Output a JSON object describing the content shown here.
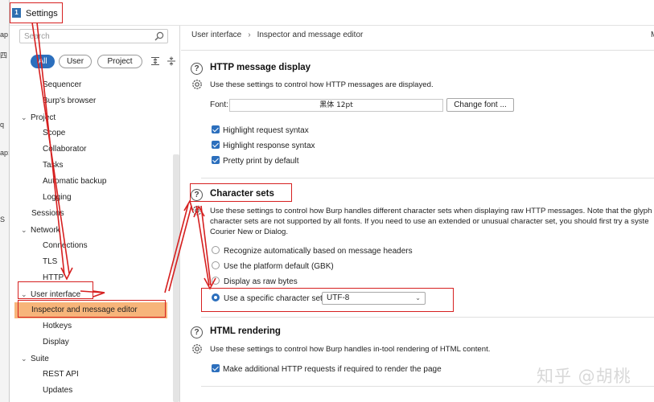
{
  "background_window": {
    "fragments": [
      "ap",
      "四",
      "q",
      "ap:",
      "S"
    ]
  },
  "window": {
    "title": "Settings",
    "app_icon": "app-logo-icon"
  },
  "sidebar": {
    "search_placeholder": "Search",
    "filters": {
      "all": "All",
      "user": "User",
      "project": "Project"
    },
    "tree": [
      {
        "label": "Sequencer",
        "level": 2
      },
      {
        "label": "Burp's browser",
        "level": 2
      },
      {
        "label": "Project",
        "level": 1,
        "expanded": true
      },
      {
        "label": "Scope",
        "level": 2
      },
      {
        "label": "Collaborator",
        "level": 2
      },
      {
        "label": "Tasks",
        "level": 2
      },
      {
        "label": "Automatic backup",
        "level": 2
      },
      {
        "label": "Logging",
        "level": 2
      },
      {
        "label": "Sessions",
        "level": 1
      },
      {
        "label": "Network",
        "level": 1,
        "expanded": true
      },
      {
        "label": "Connections",
        "level": 2
      },
      {
        "label": "TLS",
        "level": 2
      },
      {
        "label": "HTTP",
        "level": 2
      },
      {
        "label": "User interface",
        "level": 1,
        "expanded": true
      },
      {
        "label": "Inspector and message editor",
        "level": 2,
        "selected": true
      },
      {
        "label": "Hotkeys",
        "level": 2
      },
      {
        "label": "Display",
        "level": 2
      },
      {
        "label": "Suite",
        "level": 1,
        "expanded": true
      },
      {
        "label": "REST API",
        "level": 2
      },
      {
        "label": "Updates",
        "level": 2
      }
    ]
  },
  "main": {
    "breadcrumb": {
      "parent": "User interface",
      "current": "Inspector and message editor",
      "right": "Ma"
    },
    "http_display": {
      "title": "HTTP message display",
      "description": "Use these settings to control how HTTP messages are displayed.",
      "font_label": "Font:",
      "font_value": "黑体  12pt",
      "change_font": "Change font ...",
      "options": [
        "Highlight request syntax",
        "Highlight response syntax",
        "Pretty print by default"
      ]
    },
    "character_sets": {
      "title": "Character sets",
      "description_lines": [
        "Use these settings to control how Burp handles different character sets when displaying raw HTTP messages. Note that the glyph",
        "character sets are not supported by all fonts. If you need to use an extended or unusual character set, you should first try a syste",
        "Courier New or Dialog."
      ],
      "options": [
        "Recognize automatically based on message headers",
        "Use the platform default (GBK)",
        "Display as raw bytes",
        "Use a specific character set:"
      ],
      "selected_option": 3,
      "charset_value": "UTF-8"
    },
    "html_rendering": {
      "title": "HTML rendering",
      "description": "Use these settings to control how Burp handles in-tool rendering of HTML content.",
      "option": "Make additional HTTP requests if required to render the page"
    }
  },
  "colors": {
    "accent": "#2c6fbd",
    "selection": "#f7b57a",
    "annotation": "#d62020"
  },
  "watermark": "知乎 @胡桃"
}
